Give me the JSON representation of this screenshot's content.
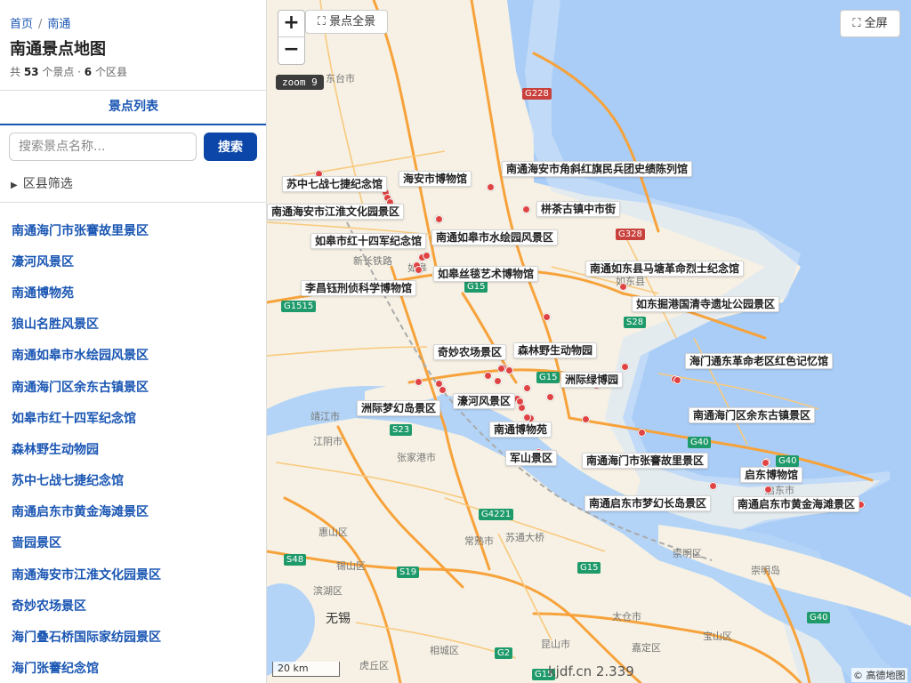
{
  "breadcrumb": {
    "home": "首页",
    "separator": "/",
    "current": "南通"
  },
  "page": {
    "title": "南通景点地图",
    "stats": {
      "prefix": "共 ",
      "spots": "53",
      "mid": " 个景点 · ",
      "districts": "6",
      "suffix": " 个区县"
    }
  },
  "tab": {
    "label": "景点列表"
  },
  "search": {
    "placeholder": "搜索景点名称...",
    "value": "",
    "button": "搜索"
  },
  "filter": {
    "icon": "triangle-right-icon",
    "label": "区县筛选"
  },
  "spot_list": [
    "南通海门市张謇故里景区",
    "濠河风景区",
    "南通博物苑",
    "狼山名胜风景区",
    "南通如皋市水绘园风景区",
    "南通海门区余东古镇景区",
    "如皋市红十四军纪念馆",
    "森林野生动物园",
    "苏中七战七捷纪念馆",
    "南通启东市黄金海滩景区",
    "啬园景区",
    "南通海安市江淮文化园景区",
    "奇妙农场景区",
    "海门叠石桥国际家纺园景区",
    "海门张謇纪念馆"
  ],
  "map": {
    "zoom_in": "+",
    "zoom_out": "−",
    "overview": "⛶ 景点全景",
    "fullscreen": "⛶ 全屏",
    "zoom_label": "zoom 9",
    "scale": "20 km",
    "watermark": "kjdf.cn 2.339",
    "attribution": "© 高德地图",
    "colors": {
      "sea": "#a9cdf6",
      "river": "#b3d4f7",
      "land": "#f6f1e4",
      "highway": "#f7a23a",
      "marker": "#e04343",
      "accent": "#0b46a8"
    },
    "place_names": [
      {
        "name": "东台市"
      },
      {
        "name": "如东县"
      },
      {
        "name": "靖江市"
      },
      {
        "name": "江阴市"
      },
      {
        "name": "张家港市"
      },
      {
        "name": "常熟市"
      },
      {
        "name": "惠山区"
      },
      {
        "name": "锡山区"
      },
      {
        "name": "滨湖区"
      },
      {
        "name": "无锡"
      },
      {
        "name": "太仓市"
      },
      {
        "name": "昆山市"
      },
      {
        "name": "嘉定区"
      },
      {
        "name": "宝山区"
      },
      {
        "name": "崇明区"
      },
      {
        "name": "崇明岛"
      },
      {
        "name": "启东市"
      },
      {
        "name": "相城区"
      },
      {
        "name": "虎丘区"
      },
      {
        "name": "如皋"
      },
      {
        "name": "新长铁路"
      },
      {
        "name": "苏通大桥"
      }
    ],
    "road_shields": [
      {
        "code": "G228"
      },
      {
        "code": "G328"
      },
      {
        "code": "G15"
      },
      {
        "code": "S28"
      },
      {
        "code": "G1515"
      },
      {
        "code": "G15"
      },
      {
        "code": "S23"
      },
      {
        "code": "G40"
      },
      {
        "code": "G40"
      },
      {
        "code": "G4221"
      },
      {
        "code": "S48"
      },
      {
        "code": "S19"
      },
      {
        "code": "G15"
      },
      {
        "code": "G40"
      },
      {
        "code": "G2"
      },
      {
        "code": "G15"
      }
    ],
    "pois": [
      {
        "name": "海安市博物馆"
      },
      {
        "name": "南通海安市角斜红旗民兵团史绩陈列馆"
      },
      {
        "name": "苏中七战七捷纪念馆"
      },
      {
        "name": "南通海安市江淮文化园景区"
      },
      {
        "name": "栟茶古镇中市街"
      },
      {
        "name": "如皋市红十四军纪念馆"
      },
      {
        "name": "南通如皋市水绘园风景区"
      },
      {
        "name": "如皋丝毯艺术博物馆"
      },
      {
        "name": "南通如东县马塘革命烈士纪念馆"
      },
      {
        "name": "李昌钰刑侦科学博物馆"
      },
      {
        "name": "如东掘港国清寺遗址公园景区"
      },
      {
        "name": "奇妙农场景区"
      },
      {
        "name": "森林野生动物园"
      },
      {
        "name": "海门通东革命老区红色记忆馆"
      },
      {
        "name": "洲际绿博园"
      },
      {
        "name": "濠河风景区"
      },
      {
        "name": "洲际梦幻岛景区"
      },
      {
        "name": "南通海门区余东古镇景区"
      },
      {
        "name": "南通博物苑"
      },
      {
        "name": "军山景区"
      },
      {
        "name": "南通海门市张謇故里景区"
      },
      {
        "name": "启东博物馆"
      },
      {
        "name": "南通启东市梦幻长岛景区"
      },
      {
        "name": "南通启东市黄金海滩景区"
      }
    ],
    "extra_markers": 21
  }
}
